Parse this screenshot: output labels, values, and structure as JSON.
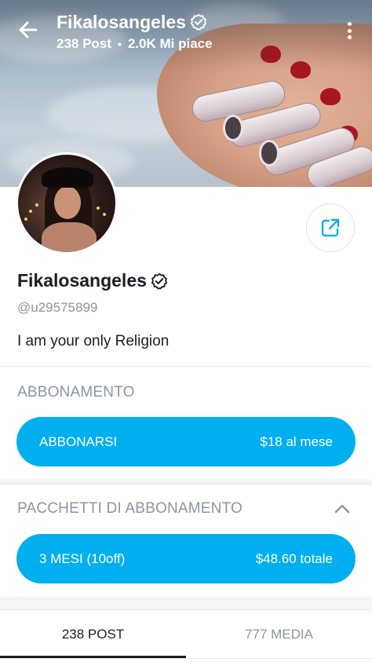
{
  "header": {
    "title": "Fikalosangeles",
    "posts_stat": "238 Post",
    "separator": "•",
    "likes_stat": "2.0K Mi piace",
    "back_icon": "arrow-left-icon",
    "menu_icon": "more-vertical-icon"
  },
  "profile": {
    "name": "Fikalosangeles",
    "handle": "@u29575899",
    "bio": "I am your only Religion",
    "verified_icon": "verified-badge-icon",
    "share_icon": "share-icon"
  },
  "subscription": {
    "label": "ABBONAMENTO",
    "button_label": "ABBONARSI",
    "button_price": "$18 al mese"
  },
  "bundles": {
    "label": "PACCHETTI DI ABBONAMENTO",
    "toggle_icon": "chevron-up-icon",
    "items": [
      {
        "label": "3 MESI (10off)",
        "price": "$48.60 totale"
      }
    ]
  },
  "tabs": [
    {
      "label": "238 POST",
      "active": true
    },
    {
      "label": "777 MEDIA",
      "active": false
    }
  ],
  "colors": {
    "accent": "#00aff0",
    "text": "#1b1d22",
    "muted": "#8a96a3"
  }
}
